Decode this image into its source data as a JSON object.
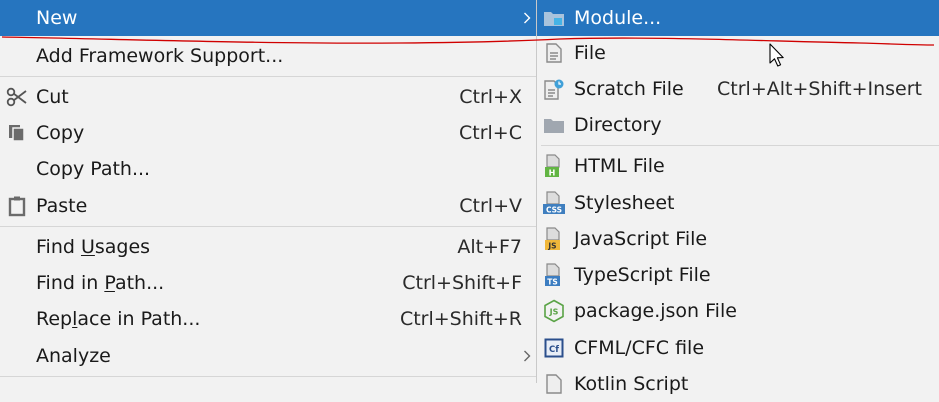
{
  "context_menu": {
    "new_label": "New",
    "add_framework_label": "Add Framework Support...",
    "cut": {
      "label": "Cut",
      "shortcut": "Ctrl+X"
    },
    "copy": {
      "label": "Copy",
      "shortcut": "Ctrl+C"
    },
    "copy_path_label": "Copy Path...",
    "paste": {
      "label": "Paste",
      "shortcut": "Ctrl+V"
    },
    "find_usages": {
      "before": "Find ",
      "mnemonic": "U",
      "after": "sages",
      "shortcut": "Alt+F7"
    },
    "find_in_path": {
      "before": "Find in ",
      "mnemonic": "P",
      "after": "ath...",
      "shortcut": "Ctrl+Shift+F"
    },
    "replace_in_path": {
      "before": "Rep",
      "mnemonic": "l",
      "after": "ace in Path...",
      "shortcut": "Ctrl+Shift+R"
    },
    "analyze_label": "Analyze"
  },
  "new_submenu": {
    "module_label": "Module...",
    "file_label": "File",
    "scratch_file": {
      "label": "Scratch File",
      "shortcut": "Ctrl+Alt+Shift+Insert"
    },
    "directory_label": "Directory",
    "html_file_label": "HTML File",
    "stylesheet_label": "Stylesheet",
    "javascript_file_label": "JavaScript File",
    "typescript_file_label": "TypeScript File",
    "package_json_label": "package.json File",
    "cfml_label": "CFML/CFC file",
    "kotlin_script_label": "Kotlin Script"
  },
  "icons": {
    "scissors": "scissors-icon",
    "copy": "copy-icon",
    "paste": "clipboard-icon",
    "module": "module-folder-icon",
    "file": "file-icon",
    "scratch": "scratch-file-icon",
    "directory": "folder-icon",
    "html": "html-file-icon",
    "css": "css-file-icon",
    "js": "js-file-icon",
    "ts": "ts-file-icon",
    "node": "nodejs-icon",
    "cfml": "cfml-icon"
  },
  "colors": {
    "menu_bg": "#f2f2f2",
    "selection": "#2675bf",
    "separator": "#d6d6d6",
    "text": "#1a1a1a",
    "annotation_red": "#d00000"
  }
}
